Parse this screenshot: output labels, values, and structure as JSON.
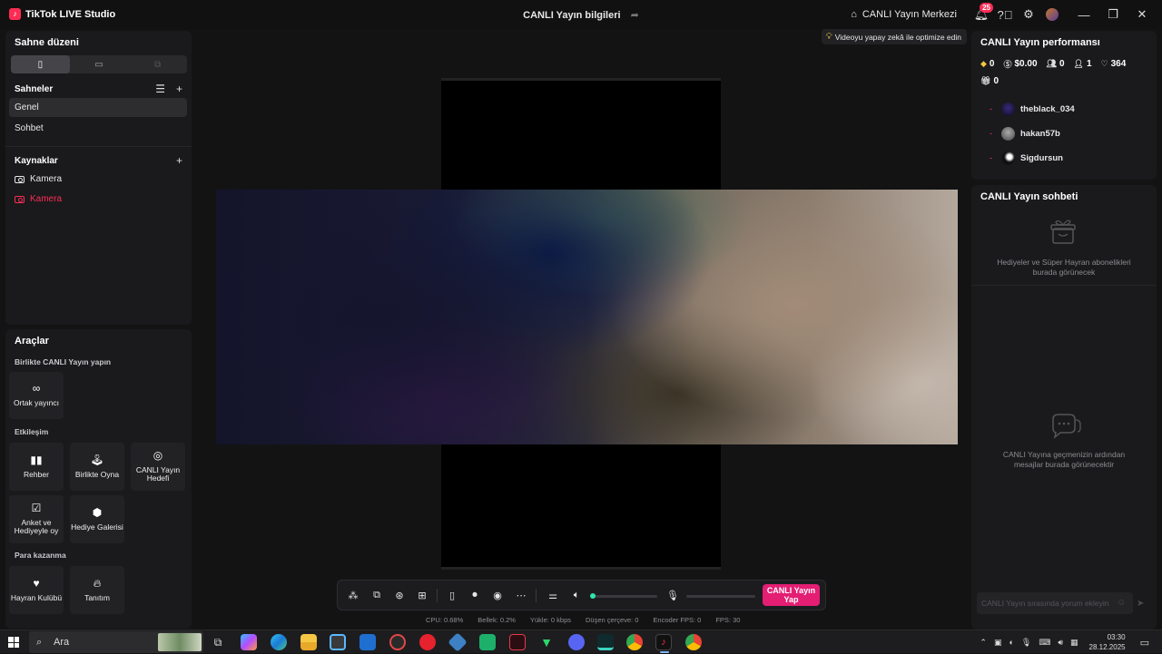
{
  "titlebar": {
    "app_name": "TikTok LIVE Studio",
    "stream_info_title": "CANLI Yayın bilgileri",
    "live_center_label": "CANLI Yayın Merkezi",
    "notification_count": "25"
  },
  "left_panel": {
    "scene_layout_title": "Sahne düzeni",
    "scenes_title": "Sahneler",
    "scenes": [
      "Genel",
      "Sohbet"
    ],
    "sources_title": "Kaynaklar",
    "sources": [
      "Kamera",
      "Kamera"
    ]
  },
  "tools": {
    "title": "Araçlar",
    "group_live_together": "Birlikte CANLI Yayın yapın",
    "co_host": "Ortak yayıncı",
    "group_interaction": "Etkileşim",
    "guide": "Rehber",
    "play_together": "Birlikte Oyna",
    "live_goal": "CANLI Yayın Hedefi",
    "poll_gift_vote": "Anket ve Hediyeyle oy",
    "gift_gallery": "Hediye Galerisi",
    "group_monetize": "Para kazanma",
    "fan_club": "Hayran Kulübü",
    "promotion": "Tanıtım"
  },
  "stage": {
    "optimize_hint": "Videoyu yapay zekâ ile optimize edin",
    "go_live_label": "CANLI Yayın Yap",
    "stats": {
      "cpu": "CPU:  0.68%",
      "memory": "Bellek:  0.2%",
      "upload": "Yükle:  0 kbps",
      "dropped": "Düşen çerçeve:  0",
      "encoder_fps": "Encoder FPS:  0",
      "fps": "FPS:  30"
    }
  },
  "performance": {
    "title": "CANLI Yayın performansı",
    "diamonds": "0",
    "earnings": "$0.00",
    "viewers": "0",
    "followers": "1",
    "likes": "364",
    "gifts": "0",
    "top_viewers": [
      {
        "name": "theblack_034"
      },
      {
        "name": "hakan57b"
      },
      {
        "name": "Sigdursun"
      }
    ]
  },
  "chat": {
    "title": "CANLI Yayın sohbeti",
    "gifts_empty": "Hediyeler ve Süper Hayran abonelikleri burada görünecek",
    "messages_empty": "CANLI Yayına geçmenizin ardından mesajlar burada görünecektir",
    "input_placeholder": "CANLI Yayın sırasında yorum ekleyin"
  },
  "taskbar": {
    "search_label": "Ara",
    "time": "03:30",
    "date": "28.12.2025"
  }
}
